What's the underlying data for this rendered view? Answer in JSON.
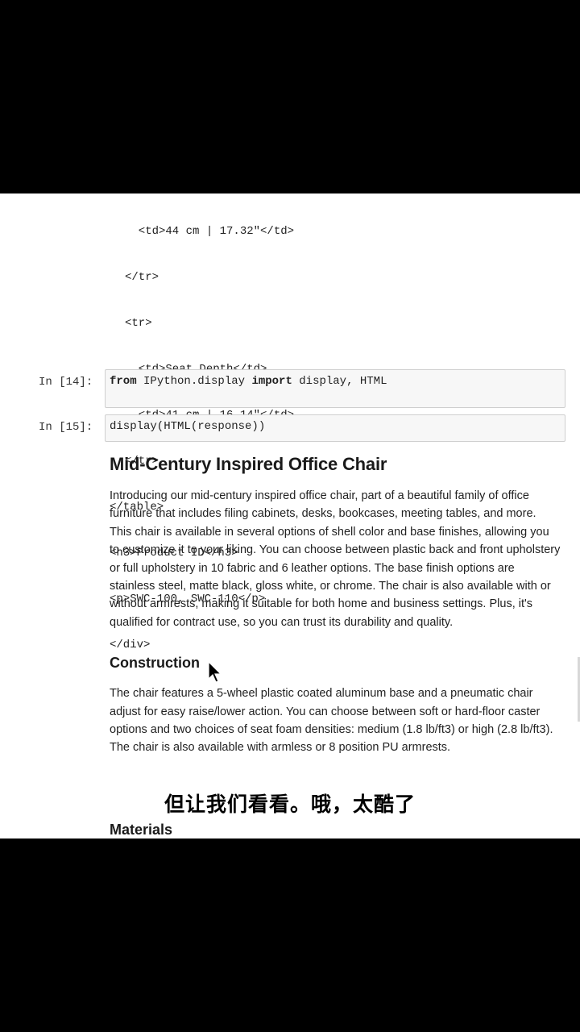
{
  "code_output": {
    "lines": [
      "  <td>44 cm | 17.32\"</td>",
      "</tr>",
      "<tr>",
      "  <td>Seat Depth</td>",
      "  <td>41 cm | 16.14\"</td>",
      "</tr>",
      "</table>",
      "<h3>Product ID</h3>",
      "<p>SWC-100, SWC-110</p>",
      "</div>"
    ]
  },
  "cells": [
    {
      "prompt": "In [14]:",
      "code_kw1": "from",
      "code_mid": " IPython.display ",
      "code_kw2": "import",
      "code_end": " display, HTML"
    },
    {
      "prompt": "In [15]:",
      "code": "display(HTML(response))"
    }
  ],
  "rendered": {
    "title": "Mid-Century Inspired Office Chair",
    "intro": "Introducing our mid-century inspired office chair, part of a beautiful family of office furniture that includes filing cabinets, desks, bookcases, meeting tables, and more. This chair is available in several options of shell color and base finishes, allowing you to customize it to your liking. You can choose between plastic back and front upholstery or full upholstery in 10 fabric and 6 leather options. The base finish options are stainless steel, matte black, gloss white, or chrome. The chair is also available with or without armrests, making it suitable for both home and business settings. Plus, it's qualified for contract use, so you can trust its durability and quality.",
    "construction_heading": "Construction",
    "construction_text": "The chair features a 5-wheel plastic coated aluminum base and a pneumatic chair adjust for easy raise/lower action. You can choose between soft or hard-floor caster options and two choices of seat foam densities: medium (1.8 lb/ft3) or high (2.8 lb/ft3). The chair is also available with armless or 8 position PU armrests.",
    "materials_heading": "Materials"
  },
  "subtitle": "但让我们看看。哦，太酷了"
}
